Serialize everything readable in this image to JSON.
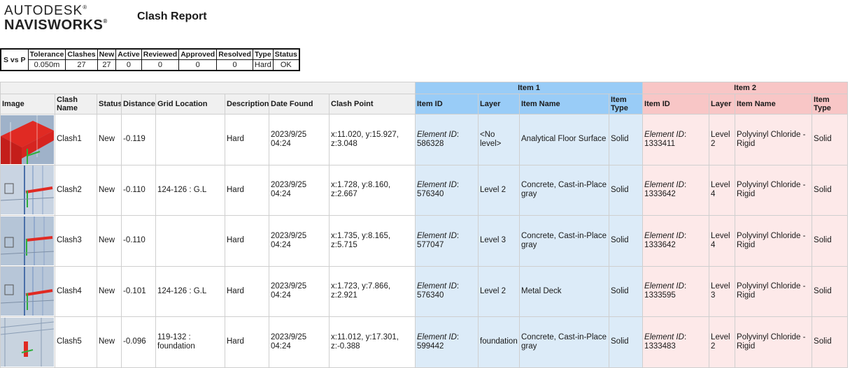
{
  "header": {
    "logo_line1": "AUTODESK",
    "logo_line2": "NAVISWORKS",
    "trademark": "®",
    "title": "Clash Report"
  },
  "summary": {
    "name": "S vs P",
    "headers": [
      "Tolerance",
      "Clashes",
      "New",
      "Active",
      "Reviewed",
      "Approved",
      "Resolved",
      "Type",
      "Status"
    ],
    "values": [
      "0.050m",
      "27",
      "27",
      "0",
      "0",
      "0",
      "0",
      "Hard",
      "OK"
    ]
  },
  "table": {
    "group_item1": "Item 1",
    "group_item2": "Item 2",
    "columns": [
      "Image",
      "Clash Name",
      "Status",
      "Distance",
      "Grid Location",
      "Description",
      "Date Found",
      "Clash Point",
      "Item ID",
      "Layer",
      "Item Name",
      "Item Type",
      "Item ID",
      "Layer",
      "Item Name",
      "Item Type"
    ],
    "element_id_label": "Element ID",
    "rows": [
      {
        "name": "Clash1",
        "status": "New",
        "distance": "-0.119",
        "grid": "",
        "desc": "Hard",
        "date": "2023/9/25 04:24",
        "point": "x:11.020, y:15.927, z:3.048",
        "i1_id": "586328",
        "i1_layer": "<No level>",
        "i1_name": "Analytical Floor Surface",
        "i1_type": "Solid",
        "i2_id": "1333411",
        "i2_layer": "Level 2",
        "i2_name": "Polyvinyl Chloride - Rigid",
        "i2_type": "Solid"
      },
      {
        "name": "Clash2",
        "status": "New",
        "distance": "-0.110",
        "grid": "124-126 : G.L",
        "desc": "Hard",
        "date": "2023/9/25 04:24",
        "point": "x:1.728, y:8.160, z:2.667",
        "i1_id": "576340",
        "i1_layer": "Level 2",
        "i1_name": "Concrete, Cast-in-Place gray",
        "i1_type": "Solid",
        "i2_id": "1333642",
        "i2_layer": "Level 4",
        "i2_name": "Polyvinyl Chloride - Rigid",
        "i2_type": "Solid"
      },
      {
        "name": "Clash3",
        "status": "New",
        "distance": "-0.110",
        "grid": "",
        "desc": "Hard",
        "date": "2023/9/25 04:24",
        "point": "x:1.735, y:8.165, z:5.715",
        "i1_id": "577047",
        "i1_layer": "Level 3",
        "i1_name": "Concrete, Cast-in-Place gray",
        "i1_type": "Solid",
        "i2_id": "1333642",
        "i2_layer": "Level 4",
        "i2_name": "Polyvinyl Chloride - Rigid",
        "i2_type": "Solid"
      },
      {
        "name": "Clash4",
        "status": "New",
        "distance": "-0.101",
        "grid": "124-126 : G.L",
        "desc": "Hard",
        "date": "2023/9/25 04:24",
        "point": "x:1.723, y:7.866, z:2.921",
        "i1_id": "576340",
        "i1_layer": "Level 2",
        "i1_name": "Metal Deck",
        "i1_type": "Solid",
        "i2_id": "1333595",
        "i2_layer": "Level 3",
        "i2_name": "Polyvinyl Chloride - Rigid",
        "i2_type": "Solid"
      },
      {
        "name": "Clash5",
        "status": "New",
        "distance": "-0.096",
        "grid": "119-132 : foundation",
        "desc": "Hard",
        "date": "2023/9/25 04:24",
        "point": "x:11.012, y:17.301, z:-0.388",
        "i1_id": "599442",
        "i1_layer": "foundation",
        "i1_name": "Concrete, Cast-in-Place gray",
        "i1_type": "Solid",
        "i2_id": "1333483",
        "i2_layer": "Level 2",
        "i2_name": "Polyvinyl Chloride - Rigid",
        "i2_type": "Solid"
      }
    ]
  }
}
